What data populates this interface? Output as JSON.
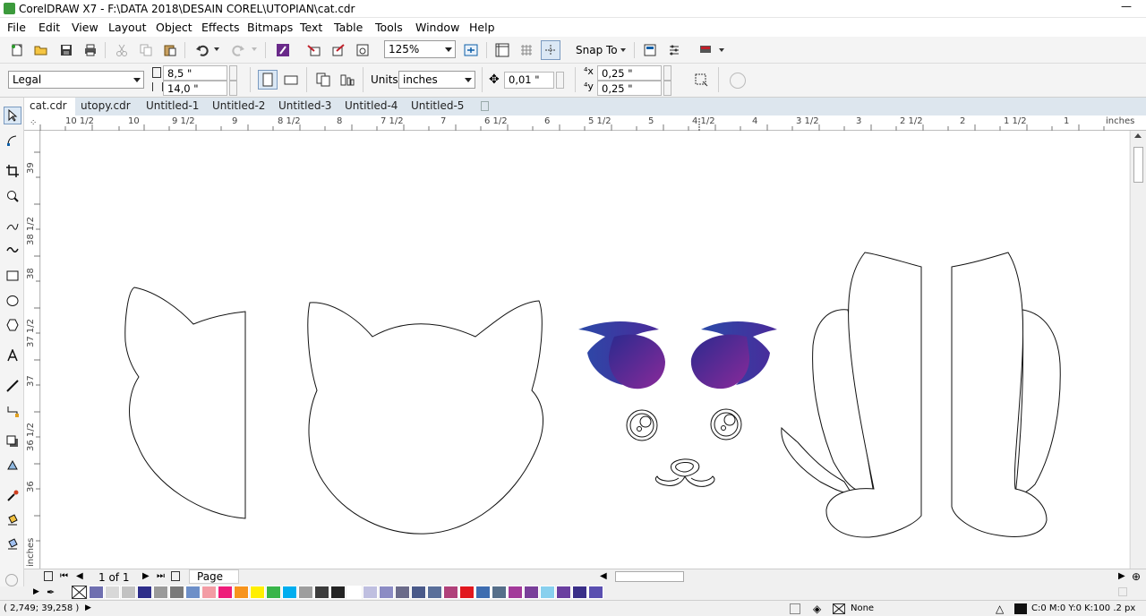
{
  "window": {
    "title": "CorelDRAW X7 - F:\\DATA 2018\\DESAIN COREL\\UTOPIAN\\cat.cdr",
    "minimize_label": "—"
  },
  "menu": [
    "File",
    "Edit",
    "View",
    "Layout",
    "Object",
    "Effects",
    "Bitmaps",
    "Text",
    "Table",
    "Tools",
    "Window",
    "Help"
  ],
  "toolbar": {
    "zoom": "125%",
    "snap_to": "Snap To"
  },
  "property_bar": {
    "page_size": "Legal",
    "width": "8,5 \"",
    "height": "14,0 \"",
    "units_label": "Units:",
    "units": "inches",
    "nudge": "0,01 \"",
    "dup_x": "0,25 \"",
    "dup_y": "0,25 \""
  },
  "tabs": [
    "cat.cdr",
    "utopy.cdr",
    "Untitled-1",
    "Untitled-2",
    "Untitled-3",
    "Untitled-4",
    "Untitled-5"
  ],
  "ruler": {
    "h_labels": [
      "10 1/2",
      "10",
      "9 1/2",
      "9",
      "8 1/2",
      "8",
      "7 1/2",
      "7",
      "6 1/2",
      "6",
      "5 1/2",
      "5",
      "4 1/2",
      "4",
      "3 1/2",
      "3",
      "2 1/2",
      "2",
      "1 1/2",
      "1"
    ],
    "h_unit": "inches",
    "v_labels": [
      "39",
      "38 1/2",
      "38",
      "37 1/2",
      "37",
      "36 1/2",
      "36"
    ],
    "v_unit": "inches"
  },
  "page_nav": {
    "count": "1 of 1",
    "page_tab": "Page 1"
  },
  "palette": [
    "#6f6fb0",
    "#d8d8d8",
    "#c2c2c2",
    "#2e2e8a",
    "#9a9a9a",
    "#7a7a7a",
    "#6d8fc8",
    "#f39ca4",
    "#ee1c7a",
    "#f7941d",
    "#ffef00",
    "#39b54a",
    "#00aeef",
    "#9e9e9e",
    "#3c3c3c",
    "#232323",
    "#ffffff",
    "#bfbfe0",
    "#8c8cc4",
    "#6b6b8a",
    "#4a5a8a",
    "#5a6f9a",
    "#b0417a",
    "#e1171e",
    "#3e6db0",
    "#566f8a",
    "#a33a9a",
    "#7a3f9a",
    "#88d0ee",
    "#6a3fa0",
    "#3a2f88",
    "#5a4fb0"
  ],
  "status": {
    "coords": "( 2,749; 39,258 )",
    "fill": "None",
    "outline": "C:0 M:0 Y:0 K:100  .2 px"
  },
  "colors": {
    "eye_start": "#2b2a8e",
    "eye_end": "#8a2a9a",
    "accent": "#0e5fa8"
  }
}
